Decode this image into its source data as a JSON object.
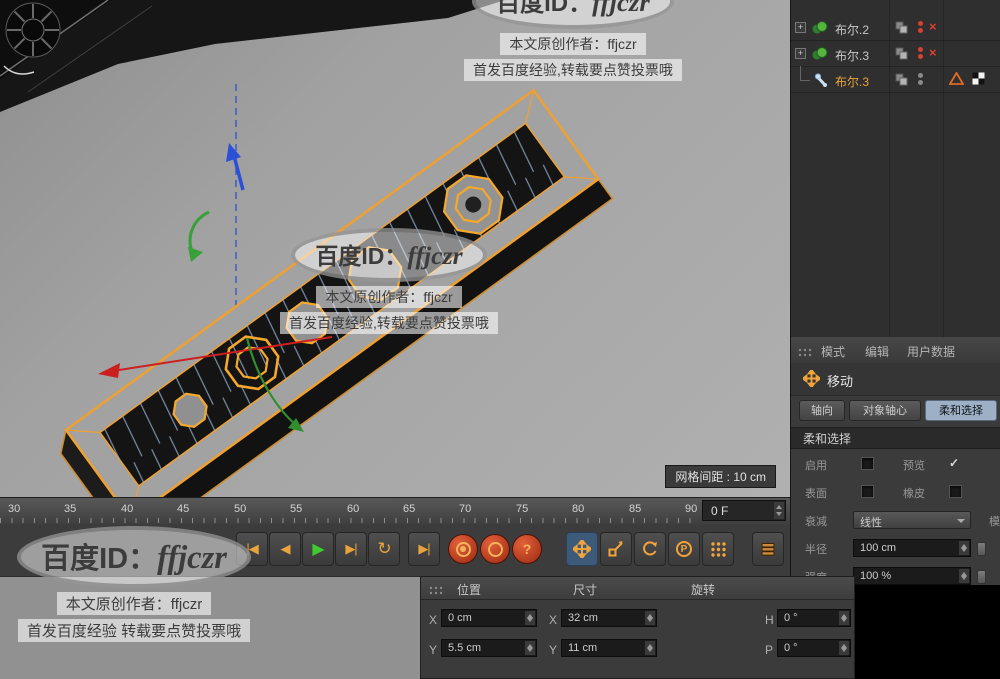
{
  "watermarks": {
    "badge_prefix": "百度ID：",
    "badge_name": "ffjczr",
    "author_line": "本文原创作者：ffjczr",
    "slogan_line_comma": "首发百度经验,转载要点赞投票哦",
    "slogan_line_space": "首发百度经验 转载要点赞投票哦"
  },
  "viewport": {
    "grid_spacing_label": "网格间距 : 10 cm"
  },
  "object_manager": {
    "rows": [
      {
        "label": "布尔.2"
      },
      {
        "label": "布尔.3"
      },
      {
        "label": "布尔.3"
      }
    ],
    "expander_glyph": "+",
    "disable_glyph": "×"
  },
  "attribute_panel": {
    "tabs": [
      "模式",
      "编辑",
      "用户数据"
    ],
    "tool_name": "移动",
    "mode_buttons": [
      "轴向",
      "对象轴心",
      "柔和选择"
    ],
    "section_title": "柔和选择",
    "fields": {
      "enable_label": "启用",
      "preview_label": "预览",
      "preview_check": "✓",
      "surface_label": "表面",
      "eraser_label": "橡皮",
      "falloff_label": "衰减",
      "falloff_value": "线性",
      "radius_label": "半径",
      "radius_value": "100 cm",
      "strength_label": "强度",
      "strength_value": "100 %",
      "clipped_label": "模"
    }
  },
  "timeline": {
    "ticks": [
      "30",
      "35",
      "40",
      "45",
      "50",
      "55",
      "60",
      "65",
      "70",
      "75",
      "80",
      "85",
      "90"
    ],
    "current_frame": "0 F"
  },
  "transport": {
    "goto_start": "|◀",
    "prev_frame": "◀",
    "play": "▶",
    "next_frame": "▶|",
    "loop": "↻",
    "goto_end": "▶|",
    "question": "?",
    "p_label": "P"
  },
  "coordinates": {
    "headers": [
      "位置",
      "尺寸",
      "旋转"
    ],
    "rows": [
      {
        "pos_label": "X",
        "pos_value": "0 cm",
        "size_label": "X",
        "size_value": "32 cm",
        "rot_label": "H",
        "rot_value": "0 °"
      },
      {
        "pos_label": "Y",
        "pos_value": "5.5 cm",
        "size_label": "Y",
        "size_value": "11 cm",
        "rot_label": "P",
        "rot_value": "0 °"
      }
    ]
  }
}
